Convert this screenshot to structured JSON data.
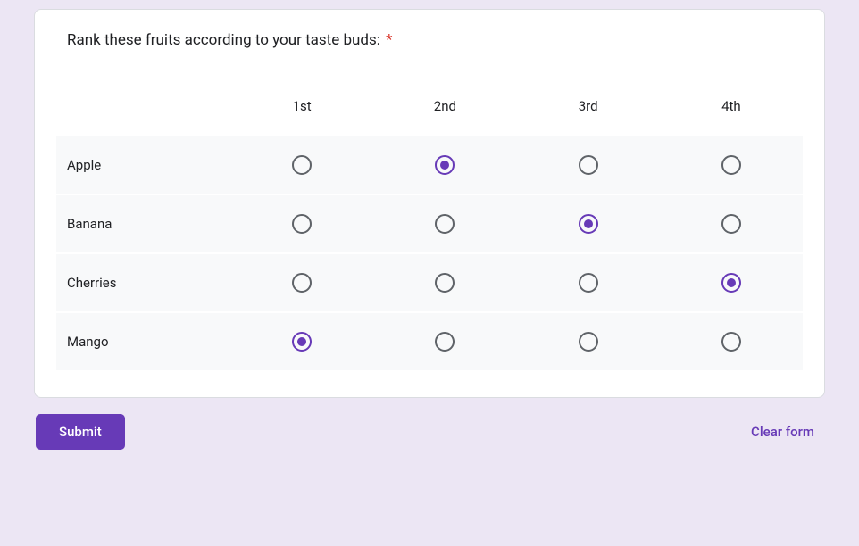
{
  "question": {
    "text": "Rank these fruits according to your taste buds:",
    "required_marker": "*"
  },
  "columns": [
    "1st",
    "2nd",
    "3rd",
    "4th"
  ],
  "rows": [
    {
      "label": "Apple",
      "selected": 1
    },
    {
      "label": "Banana",
      "selected": 2
    },
    {
      "label": "Cherries",
      "selected": 3
    },
    {
      "label": "Mango",
      "selected": 0
    }
  ],
  "footer": {
    "submit_label": "Submit",
    "clear_label": "Clear form"
  }
}
